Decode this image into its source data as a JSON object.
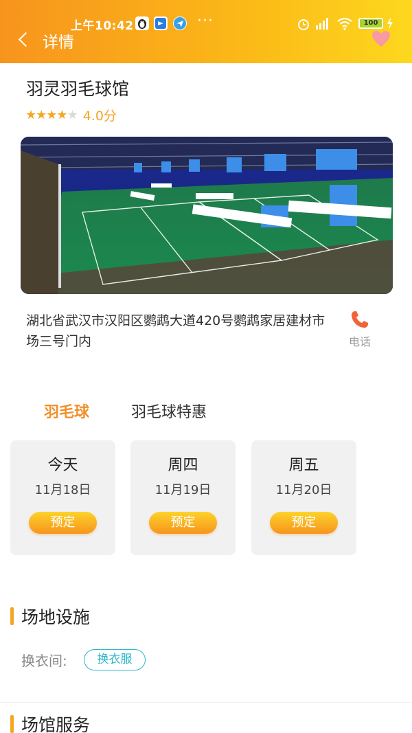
{
  "status_bar": {
    "time": "上午10:42",
    "dots": "···",
    "battery": "100"
  },
  "header": {
    "title": "详情"
  },
  "venue": {
    "name": "羽灵羽毛球馆",
    "stars_filled": 4,
    "stars_total": 5,
    "rating_text": "4.0分",
    "address": "湖北省武汉市汉阳区鹦鹉大道420号鹦鹉家居建材市场三号门内",
    "phone_label": "电话"
  },
  "tabs": [
    {
      "label": "羽毛球",
      "active": true
    },
    {
      "label": "羽毛球特惠",
      "active": false
    }
  ],
  "dates": [
    {
      "day": "今天",
      "date": "11月18日",
      "button": "预定"
    },
    {
      "day": "周四",
      "date": "11月19日",
      "button": "预定"
    },
    {
      "day": "周五",
      "date": "11月20日",
      "button": "预定"
    }
  ],
  "facilities": {
    "title": "场地设施",
    "items": [
      {
        "label": "换衣间:",
        "tag": "换衣服"
      }
    ]
  },
  "services": {
    "title": "场馆服务"
  },
  "colors": {
    "accent": "#f5a623",
    "header_start": "#f7941d",
    "header_end": "#fdd81e",
    "tag": "#2bb8c9",
    "heart": "#f79aa2"
  }
}
